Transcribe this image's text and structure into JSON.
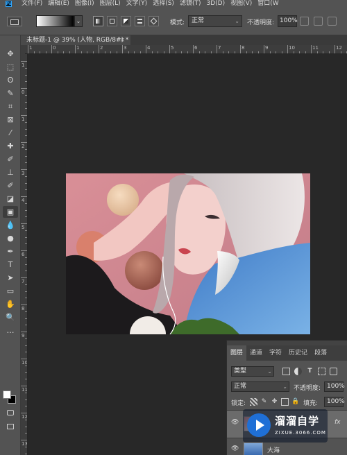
{
  "app": {
    "logo_text": "Ps"
  },
  "menu": [
    {
      "label": "文件(F)"
    },
    {
      "label": "编辑(E)"
    },
    {
      "label": "图像(I)"
    },
    {
      "label": "图层(L)"
    },
    {
      "label": "文字(Y)"
    },
    {
      "label": "选择(S)"
    },
    {
      "label": "滤镜(T)"
    },
    {
      "label": "3D(D)"
    },
    {
      "label": "视图(V)"
    },
    {
      "label": "窗口(W"
    }
  ],
  "options_bar": {
    "mode_label": "模式:",
    "mode_value": "正常",
    "opacity_label": "不透明度:",
    "opacity_value": "100%",
    "dropdown_glyph": "⌄"
  },
  "document": {
    "tab_title": "未标题-1 @ 39% (人物, RGB/8#) *",
    "close_glyph": "×"
  },
  "ruler": {
    "h_labels": [
      "1",
      "0",
      "1",
      "2",
      "3",
      "4",
      "5",
      "6",
      "7",
      "8",
      "9",
      "10",
      "11",
      "12"
    ],
    "v_labels": [
      "1",
      "0",
      "1",
      "2",
      "3",
      "4",
      "5",
      "6",
      "7",
      "8",
      "9",
      "10",
      "11",
      "12",
      "13"
    ]
  },
  "tools": [
    {
      "icon": "move-icon",
      "glyph": "✥"
    },
    {
      "icon": "marquee-icon",
      "glyph": "⬚"
    },
    {
      "icon": "lasso-icon",
      "glyph": "ʘ"
    },
    {
      "icon": "quick-select-icon",
      "glyph": "✎"
    },
    {
      "icon": "crop-icon",
      "glyph": "⌗"
    },
    {
      "icon": "frame-icon",
      "glyph": "⊠"
    },
    {
      "icon": "eyedropper-icon",
      "glyph": "⁄"
    },
    {
      "icon": "healing-icon",
      "glyph": "✚"
    },
    {
      "icon": "brush-icon",
      "glyph": "✐"
    },
    {
      "icon": "stamp-icon",
      "glyph": "⊥"
    },
    {
      "icon": "history-brush-icon",
      "glyph": "✐"
    },
    {
      "icon": "eraser-icon",
      "glyph": "◪"
    },
    {
      "icon": "gradient-icon",
      "glyph": "▣"
    },
    {
      "icon": "blur-icon",
      "glyph": "💧"
    },
    {
      "icon": "dodge-icon",
      "glyph": "●"
    },
    {
      "icon": "pen-icon",
      "glyph": "✒"
    },
    {
      "icon": "type-icon",
      "glyph": "T"
    },
    {
      "icon": "path-select-icon",
      "glyph": "➤"
    },
    {
      "icon": "shape-icon",
      "glyph": "▭"
    },
    {
      "icon": "hand-icon",
      "glyph": "✋"
    },
    {
      "icon": "zoom-icon",
      "glyph": "🔍"
    },
    {
      "icon": "more-icon",
      "glyph": "…"
    }
  ],
  "layers_panel": {
    "tabs": [
      {
        "label": "图层"
      },
      {
        "label": "通道"
      },
      {
        "label": "字符"
      },
      {
        "label": "历史记"
      },
      {
        "label": "段落"
      }
    ],
    "filter_value": "类型",
    "blend_mode": "正常",
    "opacity_label": "不透明度:",
    "opacity_value": "100%",
    "lock_label": "锁定:",
    "fill_label": "填充:",
    "fill_value": "100%",
    "fx_label": "fx",
    "layer2_name": "大海"
  },
  "watermark": {
    "title": "溜溜自学",
    "url": "ZIXUE.3066.COM"
  }
}
